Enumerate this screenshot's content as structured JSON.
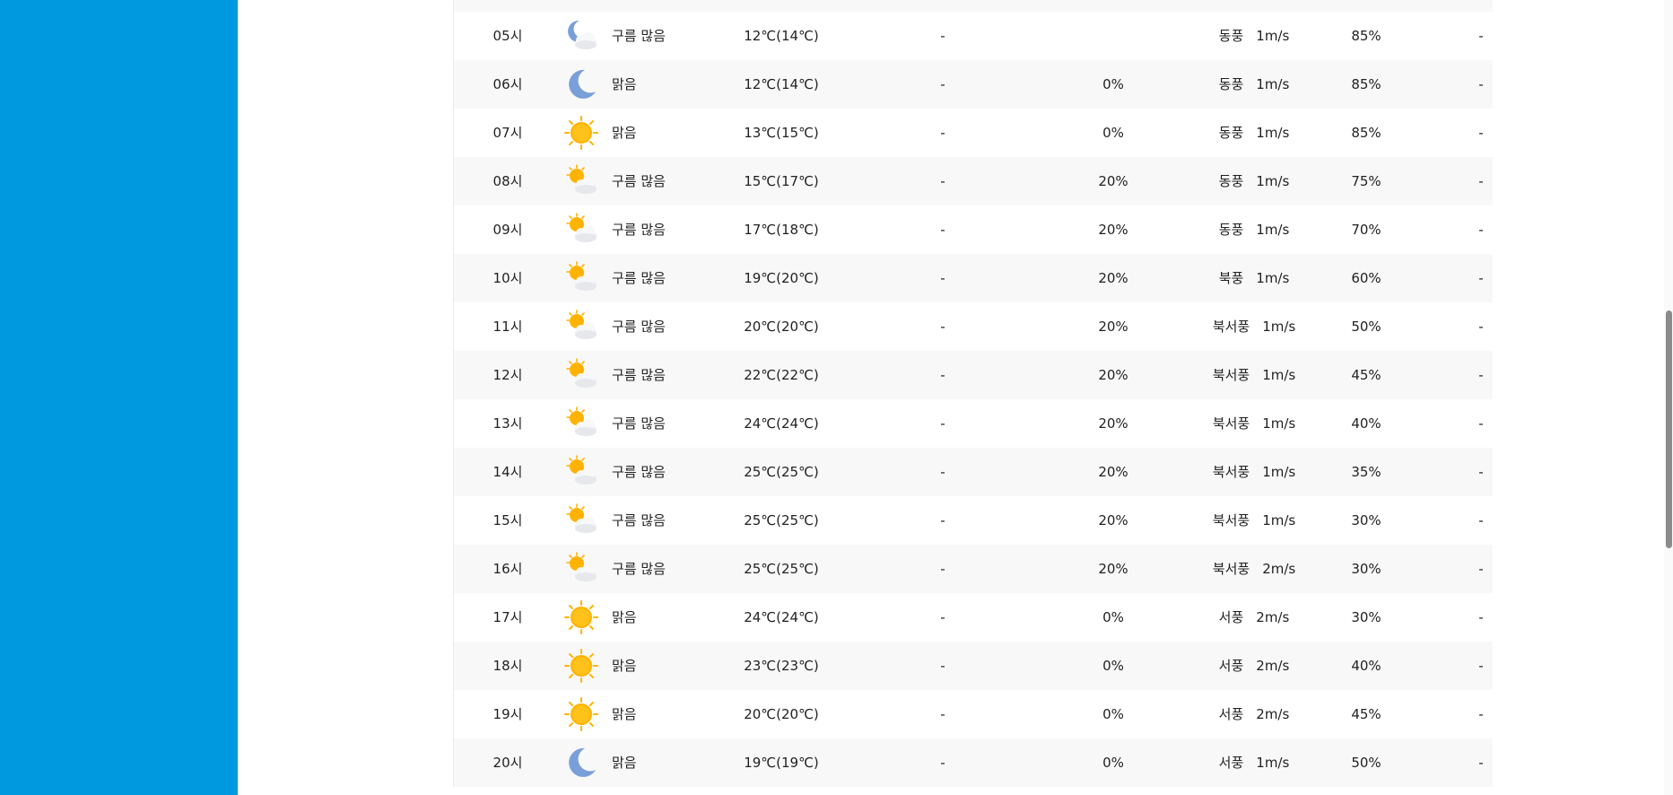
{
  "rows": [
    {
      "time": "",
      "icon": "cloudy-sun-icon",
      "condition": "",
      "temp": "",
      "precip": "",
      "prob": "",
      "wind_dir": "",
      "wind_speed": "",
      "humidity": "",
      "extra": ""
    },
    {
      "time": "05시",
      "icon": "cloudy-moon-icon",
      "condition": "구름 많음",
      "temp": "12℃(14℃)",
      "precip": "-",
      "prob": "",
      "wind_dir": "동풍",
      "wind_speed": "1m/s",
      "humidity": "85%",
      "extra": "-"
    },
    {
      "time": "06시",
      "icon": "moon-icon",
      "condition": "맑음",
      "temp": "12℃(14℃)",
      "precip": "-",
      "prob": "0%",
      "wind_dir": "동풍",
      "wind_speed": "1m/s",
      "humidity": "85%",
      "extra": "-"
    },
    {
      "time": "07시",
      "icon": "sun-icon",
      "condition": "맑음",
      "temp": "13℃(15℃)",
      "precip": "-",
      "prob": "0%",
      "wind_dir": "동풍",
      "wind_speed": "1m/s",
      "humidity": "85%",
      "extra": "-"
    },
    {
      "time": "08시",
      "icon": "cloudy-sun-icon",
      "condition": "구름 많음",
      "temp": "15℃(17℃)",
      "precip": "-",
      "prob": "20%",
      "wind_dir": "동풍",
      "wind_speed": "1m/s",
      "humidity": "75%",
      "extra": "-"
    },
    {
      "time": "09시",
      "icon": "cloudy-sun-icon",
      "condition": "구름 많음",
      "temp": "17℃(18℃)",
      "precip": "-",
      "prob": "20%",
      "wind_dir": "동풍",
      "wind_speed": "1m/s",
      "humidity": "70%",
      "extra": "-"
    },
    {
      "time": "10시",
      "icon": "cloudy-sun-icon",
      "condition": "구름 많음",
      "temp": "19℃(20℃)",
      "precip": "-",
      "prob": "20%",
      "wind_dir": "북풍",
      "wind_speed": "1m/s",
      "humidity": "60%",
      "extra": "-"
    },
    {
      "time": "11시",
      "icon": "cloudy-sun-icon",
      "condition": "구름 많음",
      "temp": "20℃(20℃)",
      "precip": "-",
      "prob": "20%",
      "wind_dir": "북서풍",
      "wind_speed": "1m/s",
      "humidity": "50%",
      "extra": "-"
    },
    {
      "time": "12시",
      "icon": "cloudy-sun-icon",
      "condition": "구름 많음",
      "temp": "22℃(22℃)",
      "precip": "-",
      "prob": "20%",
      "wind_dir": "북서풍",
      "wind_speed": "1m/s",
      "humidity": "45%",
      "extra": "-"
    },
    {
      "time": "13시",
      "icon": "cloudy-sun-icon",
      "condition": "구름 많음",
      "temp": "24℃(24℃)",
      "precip": "-",
      "prob": "20%",
      "wind_dir": "북서풍",
      "wind_speed": "1m/s",
      "humidity": "40%",
      "extra": "-"
    },
    {
      "time": "14시",
      "icon": "cloudy-sun-icon",
      "condition": "구름 많음",
      "temp": "25℃(25℃)",
      "precip": "-",
      "prob": "20%",
      "wind_dir": "북서풍",
      "wind_speed": "1m/s",
      "humidity": "35%",
      "extra": "-"
    },
    {
      "time": "15시",
      "icon": "cloudy-sun-icon",
      "condition": "구름 많음",
      "temp": "25℃(25℃)",
      "precip": "-",
      "prob": "20%",
      "wind_dir": "북서풍",
      "wind_speed": "1m/s",
      "humidity": "30%",
      "extra": "-"
    },
    {
      "time": "16시",
      "icon": "cloudy-sun-icon",
      "condition": "구름 많음",
      "temp": "25℃(25℃)",
      "precip": "-",
      "prob": "20%",
      "wind_dir": "북서풍",
      "wind_speed": "2m/s",
      "humidity": "30%",
      "extra": "-"
    },
    {
      "time": "17시",
      "icon": "sun-icon",
      "condition": "맑음",
      "temp": "24℃(24℃)",
      "precip": "-",
      "prob": "0%",
      "wind_dir": "서풍",
      "wind_speed": "2m/s",
      "humidity": "30%",
      "extra": "-"
    },
    {
      "time": "18시",
      "icon": "sun-icon",
      "condition": "맑음",
      "temp": "23℃(23℃)",
      "precip": "-",
      "prob": "0%",
      "wind_dir": "서풍",
      "wind_speed": "2m/s",
      "humidity": "40%",
      "extra": "-"
    },
    {
      "time": "19시",
      "icon": "sun-icon",
      "condition": "맑음",
      "temp": "20℃(20℃)",
      "precip": "-",
      "prob": "0%",
      "wind_dir": "서풍",
      "wind_speed": "2m/s",
      "humidity": "45%",
      "extra": "-"
    },
    {
      "time": "20시",
      "icon": "moon-icon",
      "condition": "맑음",
      "temp": "19℃(19℃)",
      "precip": "-",
      "prob": "0%",
      "wind_dir": "서풍",
      "wind_speed": "1m/s",
      "humidity": "50%",
      "extra": "-"
    }
  ],
  "colors": {
    "left_panel": "#0099df",
    "row_alt": "#f8f8f8",
    "sun": "#ffb300",
    "moon": "#7a9fd8",
    "cloud": "#f2f3f5"
  }
}
